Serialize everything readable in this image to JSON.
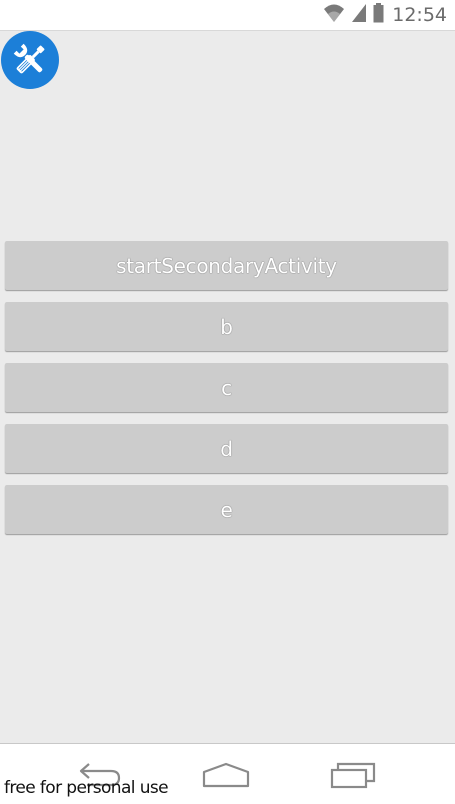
{
  "status_bar": {
    "time": "12:54",
    "icons": [
      "wifi-icon",
      "cell-signal-icon",
      "battery-icon"
    ]
  },
  "app": {
    "icon": "wrench-screwdriver-icon",
    "icon_color": "#1c7fd8"
  },
  "buttons": [
    {
      "label": "startSecondaryActivity"
    },
    {
      "label": "b"
    },
    {
      "label": "c"
    },
    {
      "label": "d"
    },
    {
      "label": "e"
    }
  ],
  "nav_bar": {
    "icons": [
      "back-icon",
      "home-icon",
      "recents-icon"
    ]
  },
  "watermark": {
    "text": "free for personal use"
  },
  "colors": {
    "background": "#ebebeb",
    "button": "#cccccc",
    "nav_icon": "#8a8a8a"
  }
}
